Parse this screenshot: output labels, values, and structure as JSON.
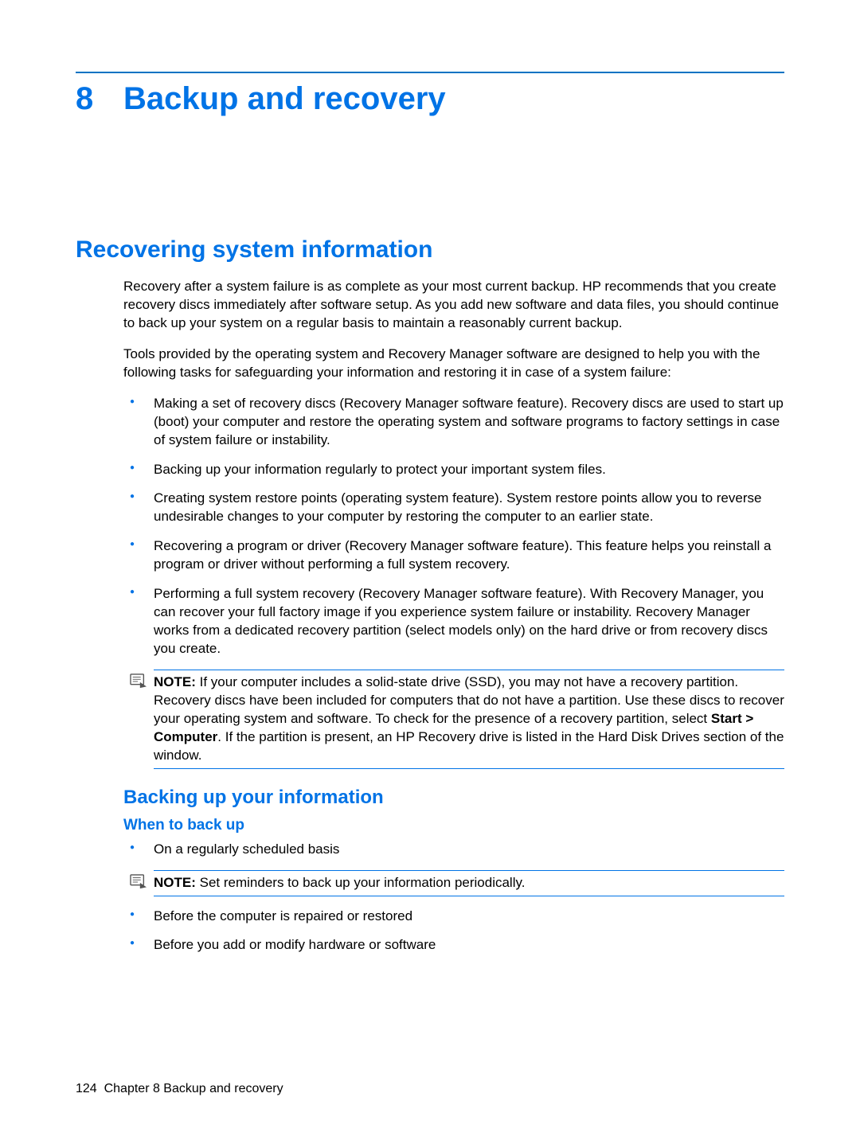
{
  "chapter": {
    "number": "8",
    "title": "Backup and recovery"
  },
  "section1": {
    "title": "Recovering system information",
    "para1": "Recovery after a system failure is as complete as your most current backup. HP recommends that you create recovery discs immediately after software setup. As you add new software and data files, you should continue to back up your system on a regular basis to maintain a reasonably current backup.",
    "para2": "Tools provided by the operating system and Recovery Manager software are designed to help you with the following tasks for safeguarding your information and restoring it in case of a system failure:",
    "bullets": [
      "Making a set of recovery discs (Recovery Manager software feature). Recovery discs are used to start up (boot) your computer and restore the operating system and software programs to factory settings in case of system failure or instability.",
      "Backing up your information regularly to protect your important system files.",
      "Creating system restore points (operating system feature). System restore points allow you to reverse undesirable changes to your computer by restoring the computer to an earlier state.",
      "Recovering a program or driver (Recovery Manager software feature). This feature helps you reinstall a program or driver without performing a full system recovery.",
      "Performing a full system recovery (Recovery Manager software feature). With Recovery Manager, you can recover your full factory image if you experience system failure or instability. Recovery Manager works from a dedicated recovery partition (select models only) on the hard drive or from recovery discs you create."
    ],
    "note1": {
      "label": "NOTE:",
      "text_pre": "If your computer includes a solid-state drive (SSD), you may not have a recovery partition. Recovery discs have been included for computers that do not have a partition. Use these discs to recover your operating system and software. To check for the presence of a recovery partition, select ",
      "bold": "Start > Computer",
      "text_post": ". If the partition is present, an HP Recovery drive is listed in the Hard Disk Drives section of the window."
    }
  },
  "section2": {
    "title": "Backing up your information",
    "sub": {
      "title": "When to back up",
      "bullet1": "On a regularly scheduled basis",
      "note": {
        "label": "NOTE:",
        "text": "Set reminders to back up your information periodically."
      },
      "bullet2": "Before the computer is repaired or restored",
      "bullet3": "Before you add or modify hardware or software"
    }
  },
  "footer": {
    "page": "124",
    "chapter_label": "Chapter 8   Backup and recovery"
  }
}
